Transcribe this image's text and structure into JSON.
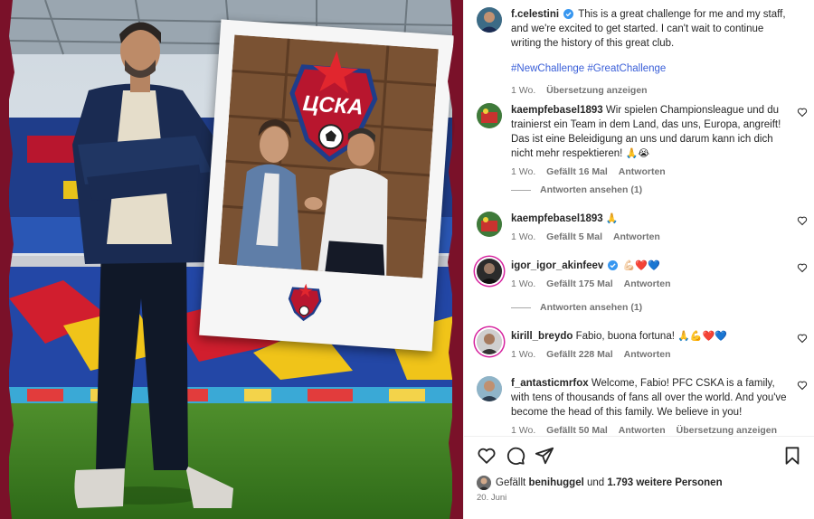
{
  "post": {
    "author": "f.celestini",
    "caption": "This is a great challenge for me and my staff, and we're excited to get started. I can't wait to continue writing the history of this great club.",
    "hashtags": "#NewChallenge #GreatChallenge",
    "time": "1 Wo.",
    "translate": "Übersetzung anzeigen",
    "crest_text": "ЦСКА"
  },
  "comments": [
    {
      "user": "kaempfebasel1893",
      "text": "Wir spielen Championsleague und du trainierst ein Team in dem Land, das uns, Europa, angreift! Das ist eine Beleidigung an uns und darum kann ich dich nicht mehr respektieren!",
      "emoji": "🙏😭",
      "time": "1 Wo.",
      "likes": "Gefällt 16 Mal",
      "reply": "Antworten",
      "view_replies": "Antworten ansehen (1)"
    },
    {
      "user": "kaempfebasel1893",
      "text": "",
      "emoji": "🙏",
      "time": "1 Wo.",
      "likes": "Gefällt 5 Mal",
      "reply": "Antworten"
    },
    {
      "user": "igor_igor_akinfeev",
      "text": "",
      "emoji": "💪🏻❤️💙",
      "time": "1 Wo.",
      "likes": "Gefällt 175 Mal",
      "reply": "Antworten",
      "view_replies": "Antworten ansehen (1)"
    },
    {
      "user": "kirill_breydo",
      "text": "Fabio, buona fortuna!",
      "emoji": "🙏💪❤️💙",
      "time": "1 Wo.",
      "likes": "Gefällt 228 Mal",
      "reply": "Antworten"
    },
    {
      "user": "f_antasticmrfox",
      "text": "Welcome, Fabio! PFC CSKA is a family, with tens of thousands of fans all over the world. And you've become the head of this family. We believe in you!",
      "time": "1 Wo.",
      "likes": "Gefällt 50 Mal",
      "reply": "Antworten",
      "translate": "Übersetzung anzeigen"
    }
  ],
  "footer": {
    "liked_prefix": "Gefällt",
    "liked_user": "benihuggel",
    "liked_mid": "und",
    "liked_count": "1.793 weitere Personen",
    "date": "20. Juni"
  },
  "icons": [
    "heart-icon",
    "comment-icon",
    "share-icon",
    "bookmark-icon",
    "verified-icon"
  ],
  "colors": {
    "link": "#3a5fd8",
    "verified": "#3897f0",
    "meta": "#737373",
    "club_red": "#7a1129"
  }
}
